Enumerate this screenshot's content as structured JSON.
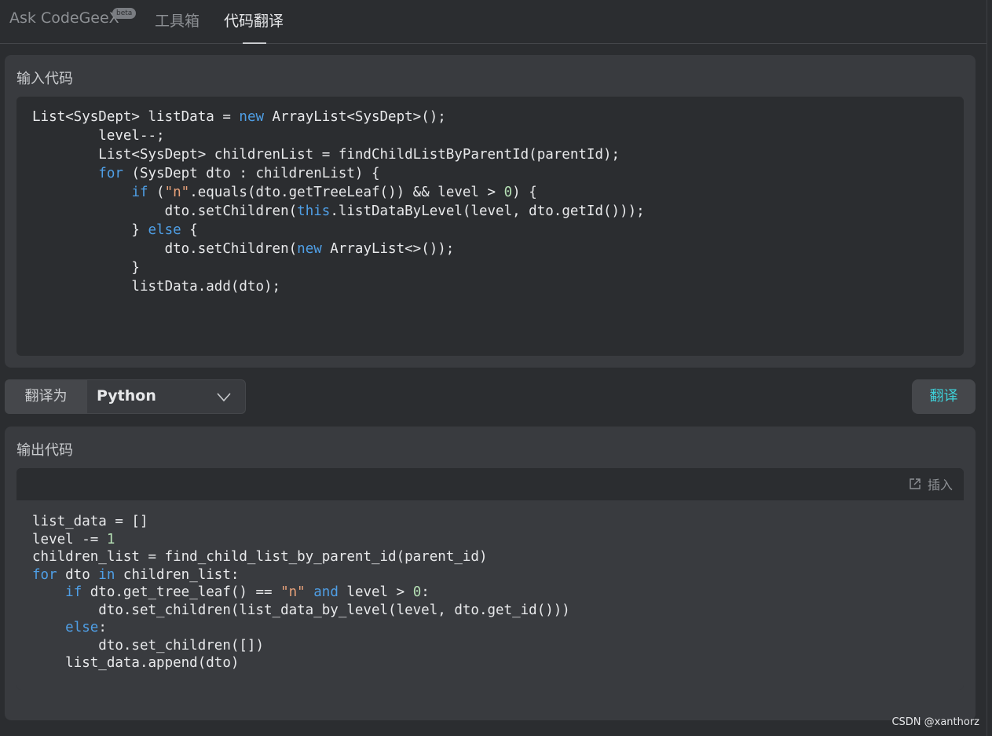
{
  "tabs": {
    "ask": "Ask CodeGeeX",
    "beta": "beta",
    "tools": "工具箱",
    "translate": "代码翻译"
  },
  "input_panel": {
    "title": "输入代码",
    "code": "List<SysDept> listData = new ArrayList<SysDept>();\n        level--;\n        List<SysDept> childrenList = findChildListByParentId(parentId);\n        for (SysDept dto : childrenList) {\n            if (\"n\".equals(dto.getTreeLeaf()) && level > 0) {\n                dto.setChildren(this.listDataByLevel(level, dto.getId()));\n            } else {\n                dto.setChildren(new ArrayList<>());\n            }\n            listData.add(dto);"
  },
  "target": {
    "label": "翻译为",
    "language": "Python",
    "translate_button": "翻译"
  },
  "output_panel": {
    "title": "输出代码",
    "insert_label": "插入",
    "code": "list_data = []\nlevel -= 1\nchildren_list = find_child_list_by_parent_id(parent_id)\nfor dto in children_list:\n    if dto.get_tree_leaf() == \"n\" and level > 0:\n        dto.set_children(list_data_by_level(level, dto.get_id()))\n    else:\n        dto.set_children([])\n    list_data.append(dto)"
  },
  "watermark": "CSDN @xanthorz",
  "colors": {
    "background": "#2b2d30",
    "panel": "#393b3f",
    "keyword": "#4f9fe6",
    "string": "#e8a27a",
    "number": "#b5dfb4",
    "accent": "#3ed0d8"
  },
  "icons": {
    "insert": "external-insert-icon",
    "dropdown": "chevron-down-icon"
  }
}
